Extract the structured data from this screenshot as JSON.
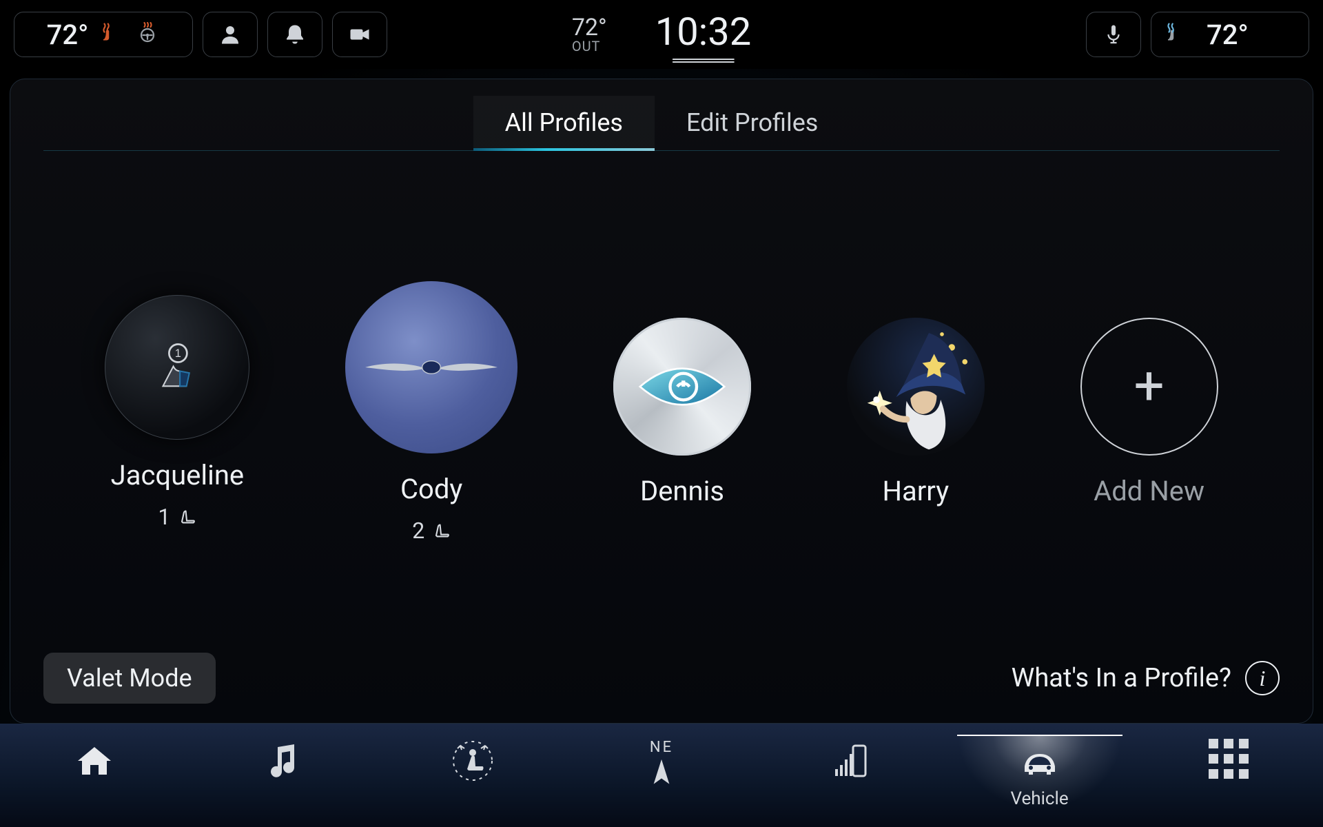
{
  "topbar": {
    "left_temp": "72°",
    "outside_temp": "72°",
    "outside_label": "OUT",
    "clock": "10:32",
    "right_temp": "72°"
  },
  "tabs": {
    "all": "All Profiles",
    "edit": "Edit Profiles"
  },
  "profiles": [
    {
      "name": "Jacqueline",
      "seat": "1"
    },
    {
      "name": "Cody",
      "seat": "2"
    },
    {
      "name": "Dennis"
    },
    {
      "name": "Harry"
    }
  ],
  "add_new_label": "Add New",
  "valet_label": "Valet Mode",
  "info_label": "What's In a Profile?",
  "bottom_nav": {
    "compass_heading": "NE",
    "vehicle_label": "Vehicle"
  }
}
